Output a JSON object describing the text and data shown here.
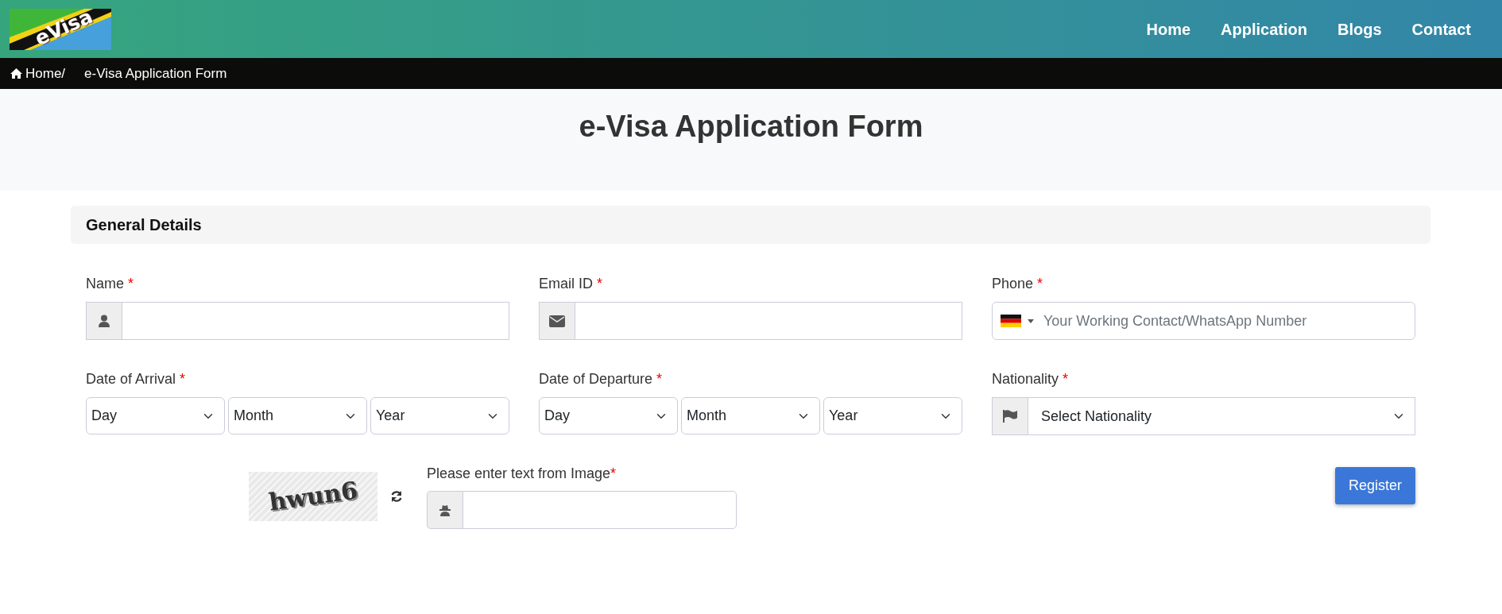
{
  "navbar": {
    "logo_text": "eVisa",
    "links": [
      {
        "label": "Home"
      },
      {
        "label": "Application"
      },
      {
        "label": "Blogs"
      },
      {
        "label": "Contact"
      }
    ]
  },
  "breadcrumb": [
    {
      "label": "Home/",
      "kind": "link"
    },
    {
      "label": "e-Visa Application Form",
      "kind": "current"
    }
  ],
  "page_title": "e-Visa Application Form",
  "section": {
    "title": "General Details"
  },
  "fields": [
    {
      "kind": "addon-input",
      "label": "Name",
      "required_mark": "*"
    },
    {
      "kind": "addon-input",
      "label": "Email ID",
      "required_mark": "*"
    },
    {
      "kind": "phone",
      "label": "Phone",
      "required_mark": "*",
      "placeholder": "Your Working Contact/WhatsApp Number"
    },
    {
      "kind": "date",
      "label": "Date of Arrival",
      "required_mark": "*",
      "selects": [
        "Day",
        "Month",
        "Year"
      ]
    },
    {
      "kind": "date",
      "label": "Date of Departure",
      "required_mark": "*",
      "selects": [
        "Day",
        "Month",
        "Year"
      ]
    },
    {
      "kind": "addon-select",
      "label": "Nationality",
      "required_mark": "*",
      "value": "Select Nationality"
    }
  ],
  "captcha": {
    "image_text": "hwun6",
    "label": "Please enter text from Image",
    "required_mark": "*"
  },
  "submit": {
    "label": "Register"
  }
}
